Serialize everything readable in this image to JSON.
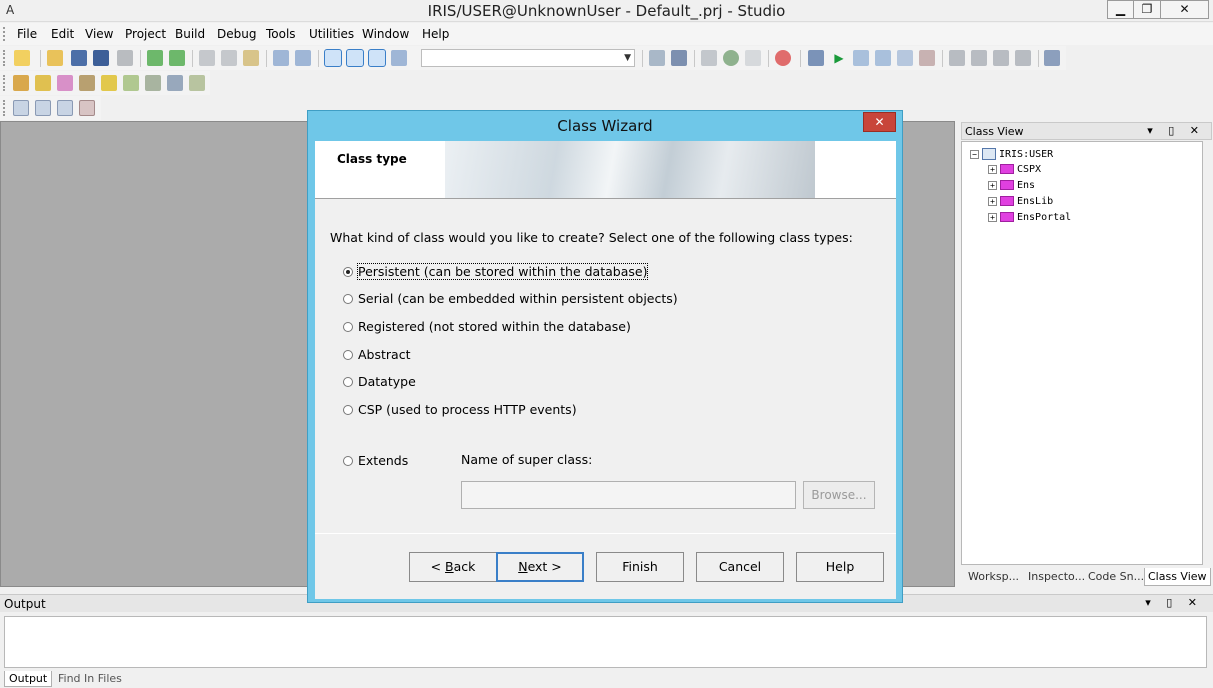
{
  "window": {
    "title": "IRIS/USER@UnknownUser - Default_.prj - Studio",
    "app_icon": "A",
    "min_glyph": "▁",
    "max_glyph": "❐",
    "close_glyph": "✕"
  },
  "menu": [
    "File",
    "Edit",
    "View",
    "Project",
    "Build",
    "Debug",
    "Tools",
    "Utilities",
    "Window",
    "Help"
  ],
  "panels": {
    "class_view": {
      "title": "Class View",
      "header_buttons": "▾ ▯ ✕",
      "root": "IRIS:USER",
      "items": [
        "CSPX",
        "Ens",
        "EnsLib",
        "EnsPortal"
      ],
      "tabs": [
        "Worksp...",
        "Inspecto...",
        "Code Sn...",
        "Class View"
      ]
    },
    "output": {
      "title": "Output",
      "header_buttons": "▾ ▯ ✕",
      "tabs": [
        "Output",
        "Find In Files"
      ]
    }
  },
  "dialog": {
    "title": "Class Wizard",
    "close_glyph": "✕",
    "heading": "Class type",
    "question": "What kind of class would you like to create? Select one of the following class types:",
    "options": [
      "Persistent  (can be stored within the database)",
      "Serial   (can be embedded within persistent objects)",
      "Registered  (not stored within the database)",
      "Abstract",
      "Datatype",
      "CSP  (used to process HTTP events)",
      "Extends"
    ],
    "selected_option": "Persistent  (can be stored within the database)",
    "super_class_label": "Name of super class:",
    "super_class_value": "",
    "browse": "Browse...",
    "buttons": {
      "back_prefix": "< ",
      "back_underlined": "B",
      "back_rest": "ack",
      "next_underlined": "N",
      "next_rest": "ext >",
      "finish": "Finish",
      "cancel": "Cancel",
      "help": "Help"
    }
  },
  "icons": {
    "toolbar_1": [
      "new-class-icon",
      "open-icon",
      "save-icon",
      "save-all-icon",
      "print-icon",
      "navigate-back-icon",
      "navigate-forward-icon",
      "cut-icon",
      "copy-icon",
      "paste-icon",
      "undo-icon",
      "redo-icon",
      "view-1-icon",
      "view-2-icon",
      "view-3-icon",
      "view-4-icon",
      "find-icon",
      "calendar-icon",
      "export-icon",
      "globe-icon",
      "page-icon",
      "stop-red-icon",
      "debug-icon",
      "run-icon",
      "step-icon",
      "stop-icon",
      "pause-icon",
      "clear-icon",
      "indent-icon",
      "outdent-icon",
      "comment-icon",
      "uncomment-icon",
      "printer-icon"
    ],
    "toolbar_2": [
      "add-property-icon",
      "add-method-icon",
      "add-parameter-icon",
      "add-index-icon",
      "add-query-icon",
      "add-trigger-icon",
      "add-projection-icon",
      "add-xdata-icon"
    ],
    "toolbar_3": [
      "window-1-icon",
      "window-2-icon",
      "window-3-icon",
      "window-4-icon"
    ]
  }
}
